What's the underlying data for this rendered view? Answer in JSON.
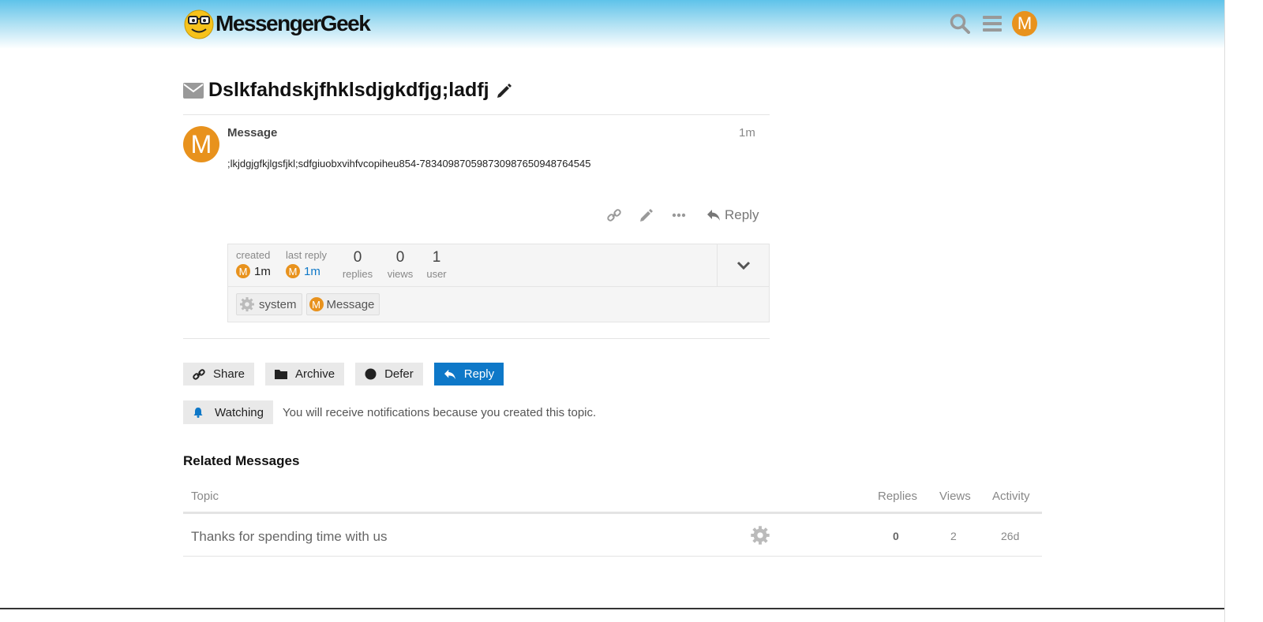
{
  "header": {
    "logo_text": "MessengerGeek",
    "avatar_letter": "M"
  },
  "topic": {
    "title": "Dslkfahdskjfhklsdjgkdfjg;ladfj"
  },
  "post": {
    "avatar_letter": "M",
    "username": "Message",
    "time": "1m",
    "body": ";lkjdgjgfkjlgsfjkl;sdfgiuobxvihfvcopiheu854-78340987059873098765094876454​5",
    "reply_label": "Reply"
  },
  "topic_map": {
    "created_label": "created",
    "created_time": "1m",
    "last_reply_label": "last reply",
    "last_reply_time": "1m",
    "replies_count": "0",
    "replies_label": "replies",
    "views_count": "0",
    "views_label": "views",
    "users_count": "1",
    "users_label": "user",
    "avatar_letter": "M",
    "participants": [
      {
        "name": "system"
      },
      {
        "name": "Message",
        "avatar_letter": "M"
      }
    ]
  },
  "footer_buttons": {
    "share": "Share",
    "archive": "Archive",
    "defer": "Defer",
    "reply": "Reply"
  },
  "notifications": {
    "button_label": "Watching",
    "text": "You will receive notifications because you created this topic."
  },
  "related": {
    "title": "Related Messages",
    "columns": {
      "topic": "Topic",
      "replies": "Replies",
      "views": "Views",
      "activity": "Activity"
    },
    "rows": [
      {
        "topic": "Thanks for spending time with us",
        "replies": "0",
        "views": "2",
        "activity": "26d"
      }
    ]
  },
  "colors": {
    "accent": "#0e78c8",
    "avatar": "#e8921d"
  }
}
